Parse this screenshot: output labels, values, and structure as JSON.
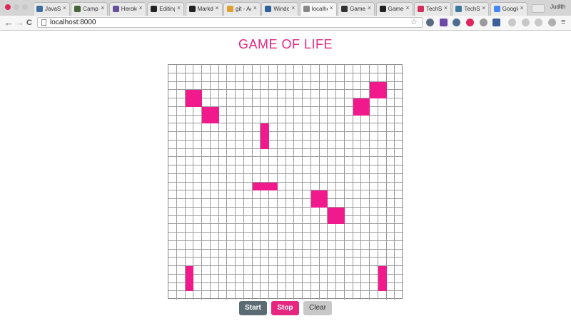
{
  "browser": {
    "tabs": [
      {
        "label": "JavaSc",
        "favicon_color": "#3e6fa0"
      },
      {
        "label": "Camper",
        "favicon_color": "#46643a"
      },
      {
        "label": "Heroku",
        "favicon_color": "#6a4e9b"
      },
      {
        "label": "Editing",
        "favicon_color": "#222222"
      },
      {
        "label": "Markdo",
        "favicon_color": "#222222"
      },
      {
        "label": "git - Ad",
        "favicon_color": "#e0a030"
      },
      {
        "label": "Windo",
        "favicon_color": "#2c5f9e"
      },
      {
        "label": "localho",
        "favicon_color": "#888888",
        "active": true
      },
      {
        "label": "Game o",
        "favicon_color": "#333333"
      },
      {
        "label": "GameO",
        "favicon_color": "#222222"
      },
      {
        "label": "TechSh",
        "favicon_color": "#d42e5b"
      },
      {
        "label": "TechSh",
        "favicon_color": "#3c7a9c"
      },
      {
        "label": "Google",
        "favicon_color": "#4285f4"
      }
    ],
    "tab_close_glyph": "×",
    "profile_label": "Judith",
    "url": "localhost:8000",
    "back_glyph": "←",
    "forward_glyph": "→",
    "reload_glyph": "C",
    "star_glyph": "☆",
    "menu_glyph": "≡"
  },
  "game": {
    "title": "GAME OF LIFE",
    "grid_size": 28,
    "live_cells": [
      [
        2,
        24
      ],
      [
        2,
        25
      ],
      [
        3,
        2
      ],
      [
        3,
        3
      ],
      [
        3,
        24
      ],
      [
        3,
        25
      ],
      [
        4,
        2
      ],
      [
        4,
        3
      ],
      [
        4,
        22
      ],
      [
        4,
        23
      ],
      [
        5,
        4
      ],
      [
        5,
        5
      ],
      [
        5,
        22
      ],
      [
        5,
        23
      ],
      [
        6,
        4
      ],
      [
        6,
        5
      ],
      [
        7,
        11
      ],
      [
        8,
        11
      ],
      [
        9,
        11
      ],
      [
        14,
        10
      ],
      [
        14,
        11
      ],
      [
        14,
        12
      ],
      [
        15,
        17
      ],
      [
        15,
        18
      ],
      [
        16,
        17
      ],
      [
        16,
        18
      ],
      [
        17,
        19
      ],
      [
        17,
        20
      ],
      [
        18,
        19
      ],
      [
        18,
        20
      ],
      [
        24,
        2
      ],
      [
        25,
        2
      ],
      [
        26,
        2
      ],
      [
        24,
        25
      ],
      [
        25,
        25
      ],
      [
        26,
        25
      ]
    ],
    "buttons": {
      "start": "Start",
      "stop": "Stop",
      "clear": "Clear"
    },
    "colors": {
      "alive": "#f01a8c",
      "title": "#e0297f",
      "start_button": "#5b6b74",
      "stop_button": "#e6267f"
    }
  }
}
